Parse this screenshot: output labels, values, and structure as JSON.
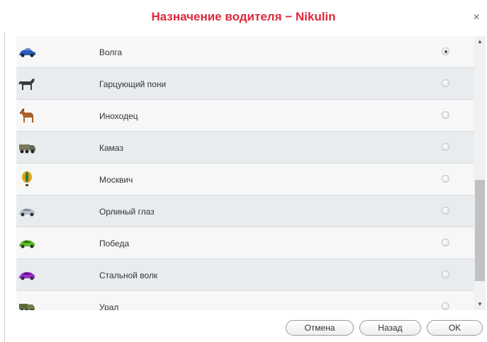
{
  "dialog": {
    "title": "Назначение водителя − Nikulin",
    "close_glyph": "×"
  },
  "vehicles": [
    {
      "label": "Волга",
      "icon": "blue-car-icon",
      "selected": true
    },
    {
      "label": "Гарцующий пони",
      "icon": "pony-icon",
      "selected": false
    },
    {
      "label": "Иноходец",
      "icon": "horse-icon",
      "selected": false
    },
    {
      "label": "Камаз",
      "icon": "truck-icon",
      "selected": false
    },
    {
      "label": "Москвич",
      "icon": "balloon-icon",
      "selected": false
    },
    {
      "label": "Орлиный глаз",
      "icon": "silver-car-icon",
      "selected": false
    },
    {
      "label": "Победа",
      "icon": "green-car-icon",
      "selected": false
    },
    {
      "label": "Стальной волк",
      "icon": "purple-car-icon",
      "selected": false
    },
    {
      "label": "Урал",
      "icon": "military-truck-icon",
      "selected": false
    }
  ],
  "buttons": {
    "cancel": "Отмена",
    "back": "Назад",
    "ok": "OK"
  },
  "colors": {
    "title": "#e0283c",
    "row_odd": "#f7f7f7",
    "row_even": "#e8ecef"
  }
}
